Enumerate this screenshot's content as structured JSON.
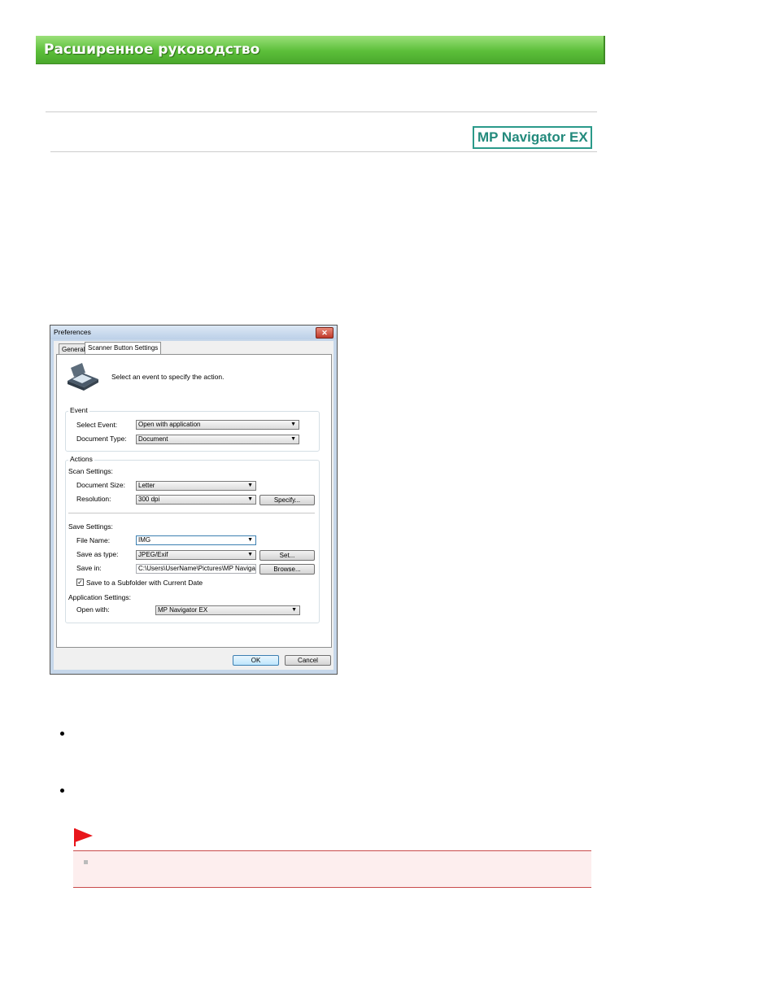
{
  "header": {
    "banner_title": "Расширенное руководство"
  },
  "product_badge": "MP Navigator EX",
  "dialog": {
    "title": "Preferences",
    "close_icon": "close-icon",
    "tabs": [
      "General",
      "Scanner Button Settings"
    ],
    "intro_text": "Select an event to specify the action.",
    "event_group": {
      "label": "Event",
      "select_event_label": "Select Event:",
      "select_event_value": "Open with application",
      "document_type_label": "Document Type:",
      "document_type_value": "Document"
    },
    "actions_group": {
      "label": "Actions",
      "scan_settings_label": "Scan Settings:",
      "document_size_label": "Document Size:",
      "document_size_value": "Letter",
      "resolution_label": "Resolution:",
      "resolution_value": "300 dpi",
      "specify_button": "Specify...",
      "save_settings_label": "Save Settings:",
      "file_name_label": "File Name:",
      "file_name_value": "IMG",
      "save_as_type_label": "Save as type:",
      "save_as_type_value": "JPEG/Exif",
      "set_button": "Set...",
      "save_in_label": "Save in:",
      "save_in_value": "C:\\Users\\UserName\\Pictures\\MP Navigato",
      "browse_button": "Browse...",
      "subfolder_checkbox_label": "Save to a Subfolder with Current Date",
      "subfolder_checked": true,
      "application_settings_label": "Application Settings:",
      "open_with_label": "Open with:",
      "open_with_value": "MP Navigator EX"
    },
    "ok_button": "OK",
    "cancel_button": "Cancel"
  },
  "colors": {
    "banner_green": "#5cbf3a",
    "badge_teal": "#238a7c",
    "note_background": "#fdeeee",
    "note_border": "#c94a4a",
    "flag_red": "#e8161b"
  }
}
